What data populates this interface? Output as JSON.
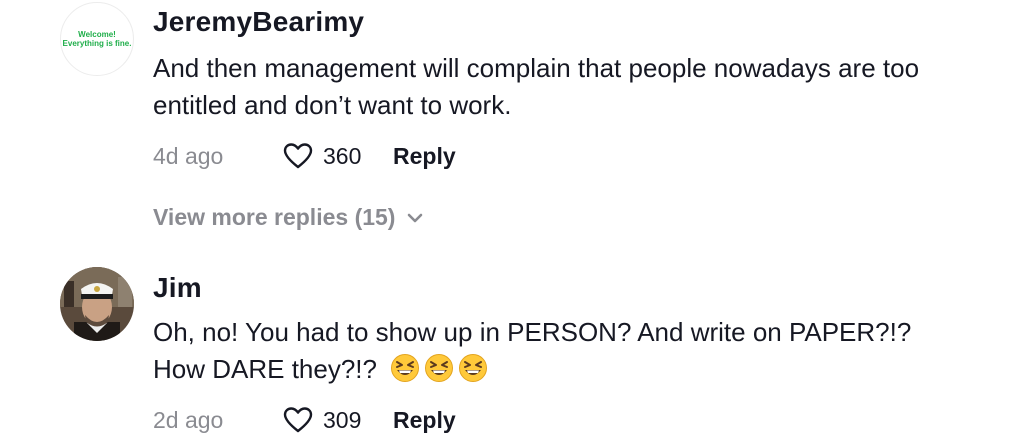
{
  "comments": [
    {
      "avatar_text_line1": "Welcome!",
      "avatar_text_line2": "Everything is fine.",
      "username": "JeremyBearimy",
      "text_line1": "And then management will complain that people nowadays are too",
      "text_line2": "entitled and don’t want to work.",
      "time": "4d ago",
      "likes": "360",
      "reply_label": "Reply",
      "view_more": "View more replies (15)"
    },
    {
      "username": "Jim",
      "text_line1": "Oh, no! You had to show up in PERSON? And write on PAPER?!?",
      "text_line2": "How DARE they?!?",
      "time": "2d ago",
      "likes": "309",
      "reply_label": "Reply"
    }
  ],
  "icons": {
    "like": "heart-outline-icon",
    "expand": "chevron-down-icon",
    "emoji": "grinning-squinting-face-emoji"
  }
}
